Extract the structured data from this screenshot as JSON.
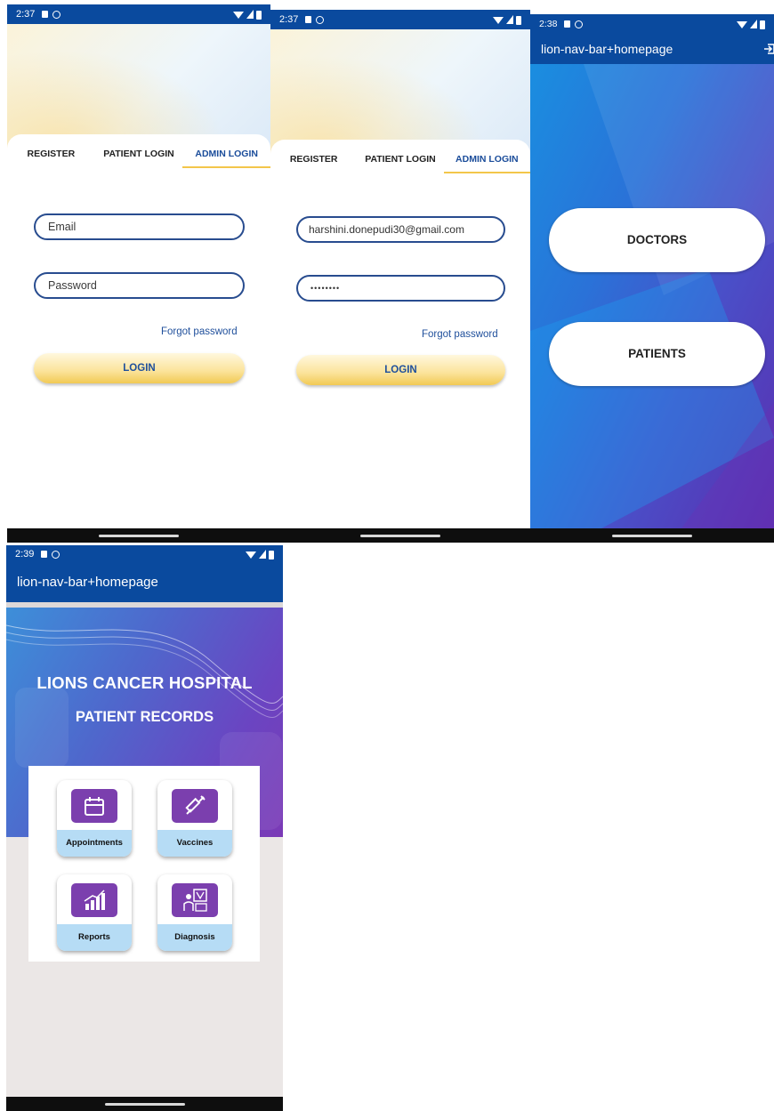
{
  "screen1": {
    "time": "2:37",
    "tabs": [
      "REGISTER",
      "PATIENT LOGIN",
      "ADMIN LOGIN"
    ],
    "email_placeholder": "Email",
    "password_placeholder": "Password",
    "forgot": "Forgot password",
    "login": "LOGIN"
  },
  "screen2": {
    "time": "2:37",
    "tabs": [
      "REGISTER",
      "PATIENT LOGIN",
      "ADMIN LOGIN"
    ],
    "email_value": "harshini.donepudi30@gmail.com",
    "password_value": "••••••••",
    "forgot": "Forgot password",
    "login": "LOGIN"
  },
  "screen3": {
    "time": "2:38",
    "app_title": "lion-nav-bar+homepage",
    "doctors": "DOCTORS",
    "patients": "PATIENTS"
  },
  "screen4": {
    "time": "2:39",
    "app_title": "lion-nav-bar+homepage",
    "hospital": "LIONS CANCER HOSPITAL",
    "subtitle": "PATIENT RECORDS",
    "tiles": [
      {
        "label": "Appointments",
        "icon": "calendar-icon"
      },
      {
        "label": "Vaccines",
        "icon": "syringe-icon"
      },
      {
        "label": "Reports",
        "icon": "bar-chart-icon"
      },
      {
        "label": "Diagnosis",
        "icon": "diagnosis-icon"
      }
    ]
  },
  "colors": {
    "status_blue": "#0a4a9e",
    "accent_gold": "#f3c64a",
    "text_blue": "#1f4f9b",
    "tile_purple": "#7b3fae",
    "tile_label_bg": "#b6dcf5"
  }
}
